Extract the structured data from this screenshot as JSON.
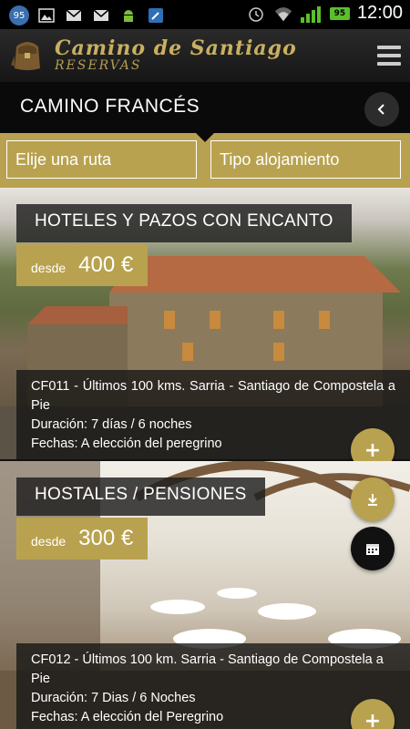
{
  "statusbar": {
    "notif_badge": "95",
    "battery": "95",
    "time": "12:00"
  },
  "app": {
    "logo_title": "Camino de Santiago",
    "logo_subtitle": "RESERVAS"
  },
  "section": {
    "title": "CAMINO FRANCÉS"
  },
  "filters": {
    "route_label": "Elije una ruta",
    "lodging_label": "Tipo alojamiento"
  },
  "cards": [
    {
      "title": "HOTELES Y PAZOS CON ENCANTO",
      "price_prefix": "desde",
      "price": "400 €",
      "description": "CF011 - Últimos 100 kms. Sarria - Santiago de Compostela a Pie",
      "duration": "Duración: 7 días / 6 noches",
      "dates": "Fechas: A elección del peregrino"
    },
    {
      "title": "HOSTALES / PENSIONES",
      "price_prefix": "desde",
      "price": "300 €",
      "description": "CF012 - Últimos 100 km. Sarria - Santiago de Compostela a Pie",
      "duration": "Duración: 7 Dias / 6 Noches",
      "dates": "Fechas: A elección del Peregrino"
    }
  ],
  "colors": {
    "accent_gold": "#b9a24f",
    "dark": "#0a0a0a"
  },
  "icons": [
    "notification-badge-icon",
    "image-icon",
    "mail-icon",
    "android-icon",
    "tools-icon",
    "alarm-icon",
    "wifi-icon",
    "signal-icon",
    "battery-icon",
    "menu-icon",
    "back-icon",
    "plus-icon",
    "download-icon",
    "calendar-icon"
  ]
}
